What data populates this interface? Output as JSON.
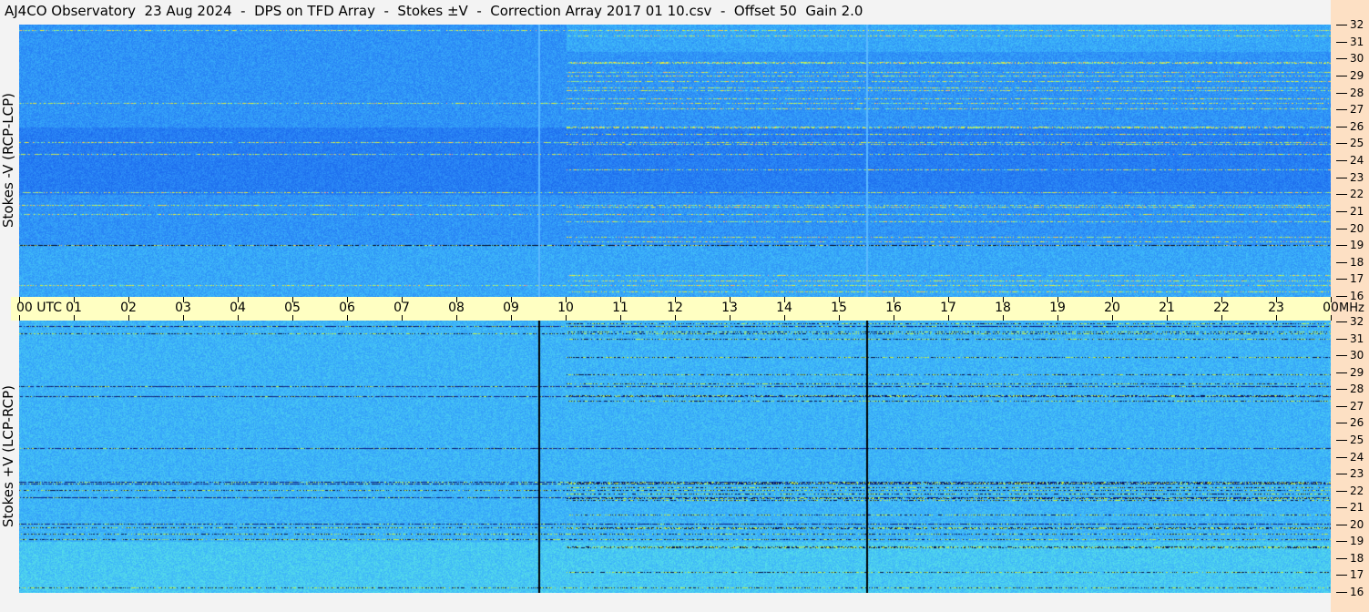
{
  "title": "AJ4CO Observatory  23 Aug 2024  -  DPS on TFD Array  -  Stokes ±V  -  Correction Array 2017 01 10.csv  -  Offset 50  Gain 2.0",
  "colors": {
    "background_blue": "#1a6fe6",
    "axis_band": "#ffffc2",
    "right_strip": "#fde0c4",
    "title_bar": "#f3f3f3"
  },
  "chart_data": {
    "type": "heatmap",
    "x_axis": {
      "range": [
        "00 UTC",
        "00"
      ],
      "tick_labels": [
        "00 UTC",
        "01",
        "02",
        "03",
        "04",
        "05",
        "06",
        "07",
        "08",
        "09",
        "10",
        "11",
        "12",
        "13",
        "14",
        "15",
        "16",
        "17",
        "18",
        "19",
        "20",
        "21",
        "22",
        "23",
        "00"
      ],
      "unit_label": "MHz"
    },
    "panels": [
      {
        "ylabel": "Stokes -V (RCP-LCP)",
        "ylim": [
          16,
          32
        ],
        "tick_labels": [
          "16",
          "17",
          "18",
          "19",
          "20",
          "21",
          "22",
          "23",
          "24",
          "25",
          "26",
          "27",
          "28",
          "29",
          "30",
          "31",
          "32"
        ]
      },
      {
        "ylabel": "Stokes +V (LCP-RCP)",
        "ylim": [
          16,
          32
        ],
        "tick_labels": [
          "16",
          "17",
          "18",
          "19",
          "20",
          "21",
          "22",
          "23",
          "24",
          "25",
          "26",
          "27",
          "28",
          "29",
          "30",
          "31",
          "32"
        ]
      }
    ],
    "vertical_markers_utc_hours": [
      9.5,
      15.5
    ]
  }
}
